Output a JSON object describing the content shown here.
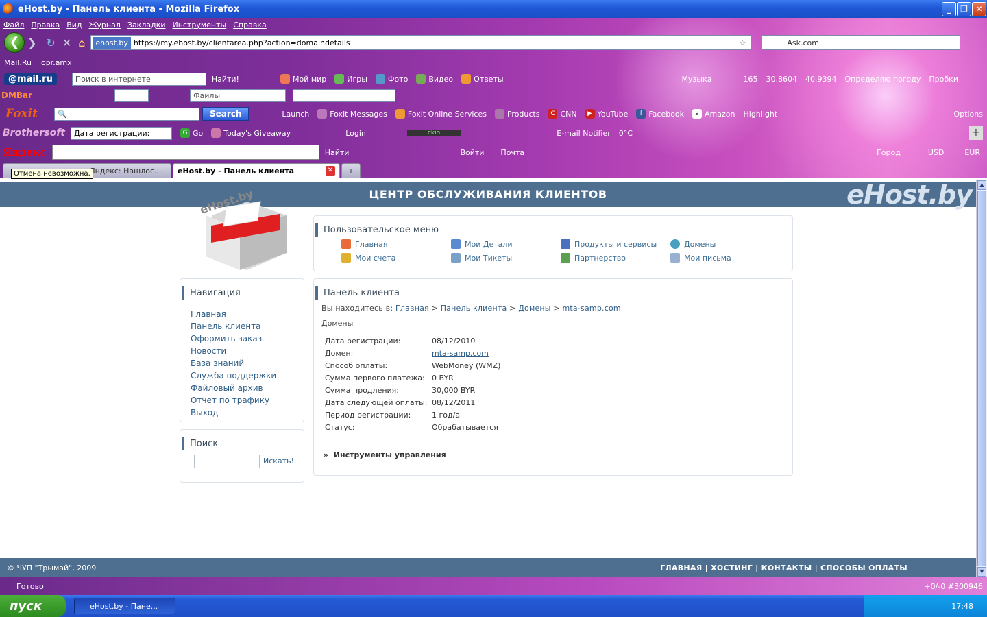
{
  "window": {
    "title": "eHost.by - Панель клиента - Mozilla Firefox"
  },
  "menu": [
    "Файл",
    "Правка",
    "Вид",
    "Журнал",
    "Закладки",
    "Инструменты",
    "Справка"
  ],
  "nav": {
    "site_badge": "ehost.by",
    "url": "https://my.ehost.by/clientarea.php?action=domaindetails",
    "search_value": "Ask.com"
  },
  "bookmarks": [
    "Mail.Ru",
    "opr.amx"
  ],
  "mailbar": {
    "logo": "@mail.ru",
    "search_placeholder": "Поиск в интернете",
    "find": "Найти!",
    "items": [
      "Мой мир",
      "Игры",
      "Фото",
      "Видео",
      "Ответы"
    ],
    "right": [
      "Музыка",
      "165",
      "30.8604",
      "40.9394",
      "Определяю погоду",
      "Пробки"
    ]
  },
  "dmbar": {
    "logo": "DMBar",
    "files": "Файлы"
  },
  "foxbar": {
    "logo": "Foxit",
    "search": "Search",
    "items": [
      "Launch",
      "Foxit Messages",
      "Foxit Online Services",
      "Products",
      "CNN",
      "YouTube",
      "Facebook",
      "Amazon",
      "Highlight"
    ],
    "options": "Options"
  },
  "brobar": {
    "logo": "Brothersoft",
    "select": "Дата регистрации:",
    "items": [
      "Go",
      "Today's Giveaway",
      "Login",
      "E-mail Notifier",
      "0°C"
    ],
    "player": "ckin"
  },
  "yabar": {
    "logo": "Яндекс",
    "find": "Найти",
    "items": [
      "Войти",
      "Почта"
    ],
    "right": [
      "Город",
      "USD",
      "EUR"
    ]
  },
  "tabs": [
    {
      "label": "Яндекс: Нашлос..."
    },
    {
      "label": "eHost.by - Панель клиента"
    }
  ],
  "tooltip": "Отмена невозможна.",
  "page": {
    "header": "ЦЕНТР ОБСЛУЖИВАНИЯ КЛИЕНТОВ",
    "brand": "eHost.by",
    "logo_text": "eHost.by",
    "user_menu": {
      "title": "Пользовательское меню",
      "items": [
        "Главная",
        "Мои счета",
        "Мои Детали",
        "Мои Тикеты",
        "Продукты и сервисы",
        "Партнерство",
        "Домены",
        "Мои письма"
      ]
    },
    "navigation": {
      "title": "Навигация",
      "items": [
        "Главная",
        "Панель клиента",
        "Оформить заказ",
        "Новости",
        "База знаний",
        "Служба поддержки",
        "Файловый архив",
        "Отчет по трафику",
        "Выход"
      ]
    },
    "search": {
      "title": "Поиск",
      "button": "Искать!"
    },
    "panel": {
      "title": "Панель клиента",
      "crumb_prefix": "Вы находитесь в:",
      "crumbs": [
        "Главная",
        "Панель клиента",
        "Домены",
        "mta-samp.com"
      ],
      "section": "Домены",
      "details": [
        {
          "k": "Дата регистрации:",
          "v": "08/12/2010"
        },
        {
          "k": "Домен:",
          "v": "mta-samp.com"
        },
        {
          "k": "Способ оплаты:",
          "v": "WebMoney (WMZ)"
        },
        {
          "k": "Сумма первого платежа:",
          "v": "0 BYR"
        },
        {
          "k": "Сумма продления:",
          "v": "30,000 BYR"
        },
        {
          "k": "Дата следующей оплаты:",
          "v": "08/12/2011"
        },
        {
          "k": "Период регистрации:",
          "v": "1 год/а"
        },
        {
          "k": "Статус:",
          "v": "Обрабатывается"
        }
      ],
      "tools": "Инструменты управления"
    },
    "footer": {
      "left": "© ЧУП \"Трымай\", 2009",
      "right": "ГЛАВНАЯ | ХОСТИНГ | КОНТАКТЫ | СПОСОБЫ ОПЛАТЫ"
    }
  },
  "status": {
    "text": "Готово",
    "right": "+0/-0  #300946"
  },
  "taskbar": {
    "start": "пуск",
    "task": "eHost.by - Пане...",
    "clock": "17:48"
  }
}
